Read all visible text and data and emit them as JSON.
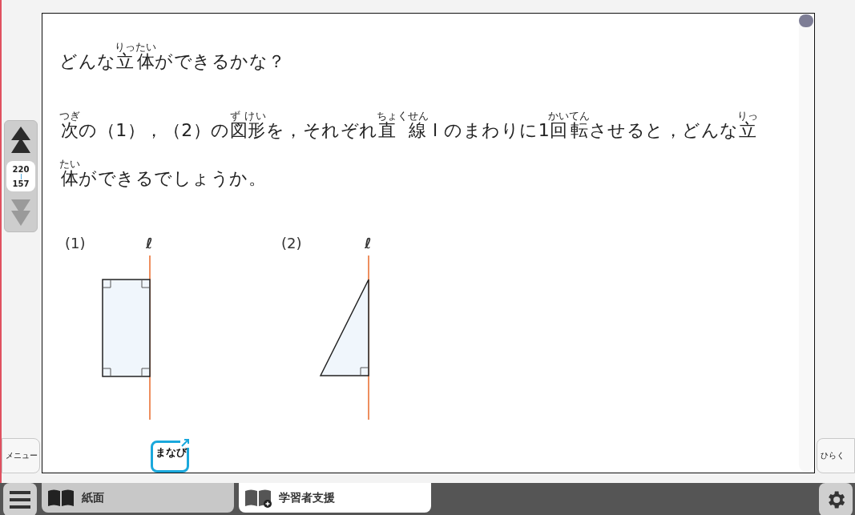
{
  "side_nav": {
    "up_disabled": false,
    "down_disabled": true,
    "current": "220",
    "total": "157"
  },
  "menu_button": "メニュー",
  "open_button": "ひらく",
  "page": {
    "title": [
      {
        "text": "どんな"
      },
      {
        "text": "立体",
        "ruby": "りったい"
      },
      {
        "text": "ができるかな？"
      }
    ],
    "question": [
      [
        {
          "text": "次",
          "ruby": "つぎ"
        },
        {
          "text": "の（1），（2）の"
        },
        {
          "text": "図形",
          "ruby": "ず けい"
        },
        {
          "text": "を，それぞれ"
        },
        {
          "text": "直 線",
          "ruby": "ちょくせん"
        },
        {
          "text": " l のまわりに1"
        },
        {
          "text": "回転",
          "ruby": "かいてん"
        },
        {
          "text": "させると，どんな"
        },
        {
          "text": "立",
          "ruby": "りっ"
        }
      ],
      [
        {
          "text": "体",
          "ruby": "たい"
        },
        {
          "text": "ができるでしょうか。"
        }
      ]
    ],
    "figures": [
      {
        "label": "(1)",
        "axis": "ℓ",
        "kind": "rectangle"
      },
      {
        "label": "(2)",
        "axis": "ℓ",
        "kind": "triangle"
      }
    ],
    "badge": "まなび"
  },
  "tabs": [
    {
      "label": "紙面",
      "selected": false,
      "kind": "book"
    },
    {
      "label": "学習者支援",
      "selected": true,
      "kind": "book-plus"
    }
  ]
}
